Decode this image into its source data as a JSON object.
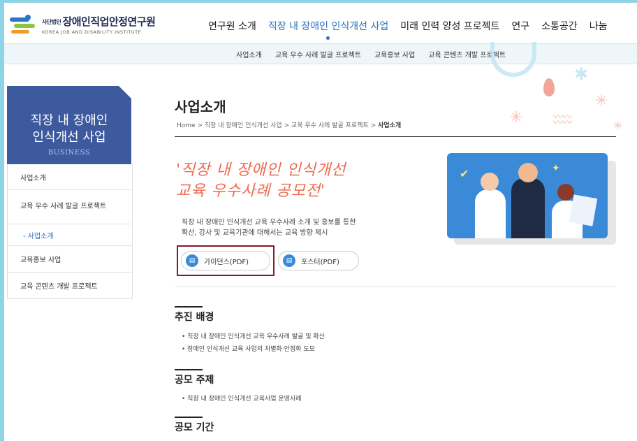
{
  "header": {
    "logo_small": "사단법인",
    "logo_name": "장애인직업안정연구원",
    "logo_en": "KOREA JOB AND DISABILITY INSTITUTE",
    "nav": [
      "연구원 소개",
      "직장 내 장애인 인식개선 사업",
      "미래 인력 양성 프로젝트",
      "연구",
      "소통공간",
      "나눔"
    ],
    "nav_active_index": 1
  },
  "subnav": [
    "사업소개",
    "교육 우수 사례 발굴 프로젝트",
    "교육홍보 사업",
    "교육 콘텐츠 개발 프로젝트"
  ],
  "sidebar": {
    "title_line1": "직장 내 장애인",
    "title_line2": "인식개선 사업",
    "subtitle": "BUSINESS",
    "items": [
      "사업소개",
      "교육 우수 사례 발굴 프로젝트",
      "- 사업소개",
      "교육홍보 사업",
      "교육 콘텐츠 개발 프로젝트"
    ],
    "colors": {
      "head_bg": "#3d5a9e",
      "active_sub": "#2f63b8"
    }
  },
  "content": {
    "page_title": "사업소개",
    "breadcrumb": "Home > 직장 내 장애인 인식개선 사업 > 교육 우수 사례 발굴 프로젝트 > ",
    "breadcrumb_current": "사업소개",
    "headline_line1": "'직장 내 장애인 인식개선",
    "headline_line2": "교육 우수사례 공모전'",
    "intro_line1": "직장 내 장애인 인식개선 교육 우수사례 소개 및 홍보를 통한",
    "intro_line2": "확산, 강사 및 교육기관에 대해서는 교육 방향 제시",
    "buttons": {
      "guidance": "가이던스(PDF)",
      "poster": "포스터(PDF)"
    },
    "sections": [
      {
        "title": "추진 배경",
        "bullets": [
          "• 직장 내 장애인 인식개선 교육 우수사례 발굴 및 확산",
          "• 장애인 인식개선 교육 사업의 차별화·안정화 도모"
        ]
      },
      {
        "title": "공모 주제",
        "bullets": [
          "• 직장 내 장애인 인식개선 교육사업 운영사례"
        ]
      },
      {
        "title": "공모 기간",
        "bullets": []
      }
    ],
    "colors": {
      "headline": "#ef6a4e",
      "accent": "#3b8ad8",
      "highlight_box": "#7a1f2b"
    }
  }
}
